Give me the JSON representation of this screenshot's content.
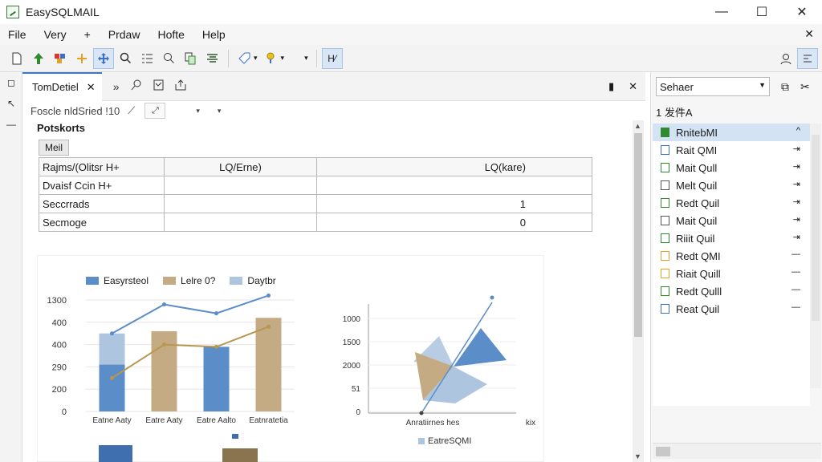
{
  "window": {
    "title": "EasySQLMAIL",
    "controls": [
      "—",
      "☐",
      "✕"
    ]
  },
  "menu": {
    "items": [
      "File",
      "Very",
      "+",
      "Prdaw",
      "Hofte",
      "Help"
    ],
    "close_doc": "✕"
  },
  "doc": {
    "tab_label": "TomDetiel",
    "tab_close": "✕",
    "breadcrumb": "Foscle nldSried !10",
    "section_title": "Potskorts",
    "mail_tab": "Meil",
    "table": {
      "rows": [
        [
          "Rajms/(Olitsr H+",
          "LQ/Erne)",
          "LQ(kare)"
        ],
        [
          "Dvaisf Ccin H+",
          "",
          ""
        ],
        [
          "Seccrrads",
          "",
          "1"
        ],
        [
          "Secmoge",
          "",
          "0"
        ]
      ]
    }
  },
  "chart_data": [
    {
      "type": "bar",
      "legend": [
        "Easyrsteol",
        "Lelre 0?",
        "Daytbr"
      ],
      "categories": [
        "Eatne Aaty",
        "Eatre Aaty",
        "Eatre Aalto",
        "Eatnratetia"
      ],
      "yticks": [
        "1300",
        "400",
        "400",
        "290",
        "200",
        "0"
      ],
      "ylim": [
        0,
        500
      ],
      "series": [
        {
          "name": "Easyrsteol",
          "values": [
            210,
            0,
            290,
            0
          ]
        },
        {
          "name": "Lelre 0?",
          "values": [
            0,
            360,
            0,
            420
          ]
        },
        {
          "name": "Daytbr",
          "values": [
            350,
            0,
            0,
            0
          ]
        }
      ],
      "lines": [
        {
          "name": "line-blue",
          "values": [
            350,
            480,
            440,
            520
          ]
        },
        {
          "name": "line-tan",
          "values": [
            150,
            300,
            290,
            380
          ]
        }
      ]
    },
    {
      "type": "scatter",
      "yticks": [
        "1000",
        "1500",
        "2000",
        "51",
        "0"
      ],
      "xlabel": "Anratiirnes hes",
      "xright": "kix",
      "legend": [
        "EatreSQMI"
      ]
    }
  ],
  "colors": {
    "blue": "#5b8dc8",
    "tan": "#c5ab84",
    "lightblue": "#aec5e0",
    "accent": "#3c78c3"
  },
  "sidebar": {
    "search": "Sehaer",
    "header": "1 发件A",
    "items": [
      {
        "label": "RnitebMI",
        "arrow": "^"
      },
      {
        "label": "Rait QMI",
        "arrow": "⇥"
      },
      {
        "label": "Mait Qull",
        "arrow": "⇥"
      },
      {
        "label": "Melt Quil",
        "arrow": "⇥"
      },
      {
        "label": "Redt Quil",
        "arrow": "⇥"
      },
      {
        "label": "Mait Quil",
        "arrow": "⇥"
      },
      {
        "label": "Riiit Quil",
        "arrow": "⇥"
      },
      {
        "label": "Redt QMI",
        "arrow": "—"
      },
      {
        "label": "Riait Quill",
        "arrow": "—"
      },
      {
        "label": "Redt Qulll",
        "arrow": "—"
      },
      {
        "label": "Reat Quil",
        "arrow": "—"
      }
    ]
  }
}
